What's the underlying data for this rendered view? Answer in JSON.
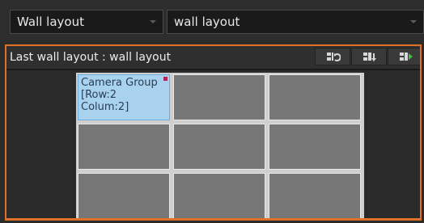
{
  "top_bar": {
    "layout_select_value": "Wall layout",
    "wall_select_value": "wall layout"
  },
  "panel": {
    "title": "Last wall layout : wall layout",
    "toolbar": {
      "icons": [
        "wall-layout-reset-icon",
        "wall-layout-save-icon",
        "wall-layout-play-icon"
      ]
    }
  },
  "wall": {
    "selected_cell_text": "Camera Group\n[Row:2\nColum:2]"
  },
  "colors": {
    "accent": "#e0702a",
    "selected_cell": "#a9d2ef",
    "cell": "#777777"
  }
}
